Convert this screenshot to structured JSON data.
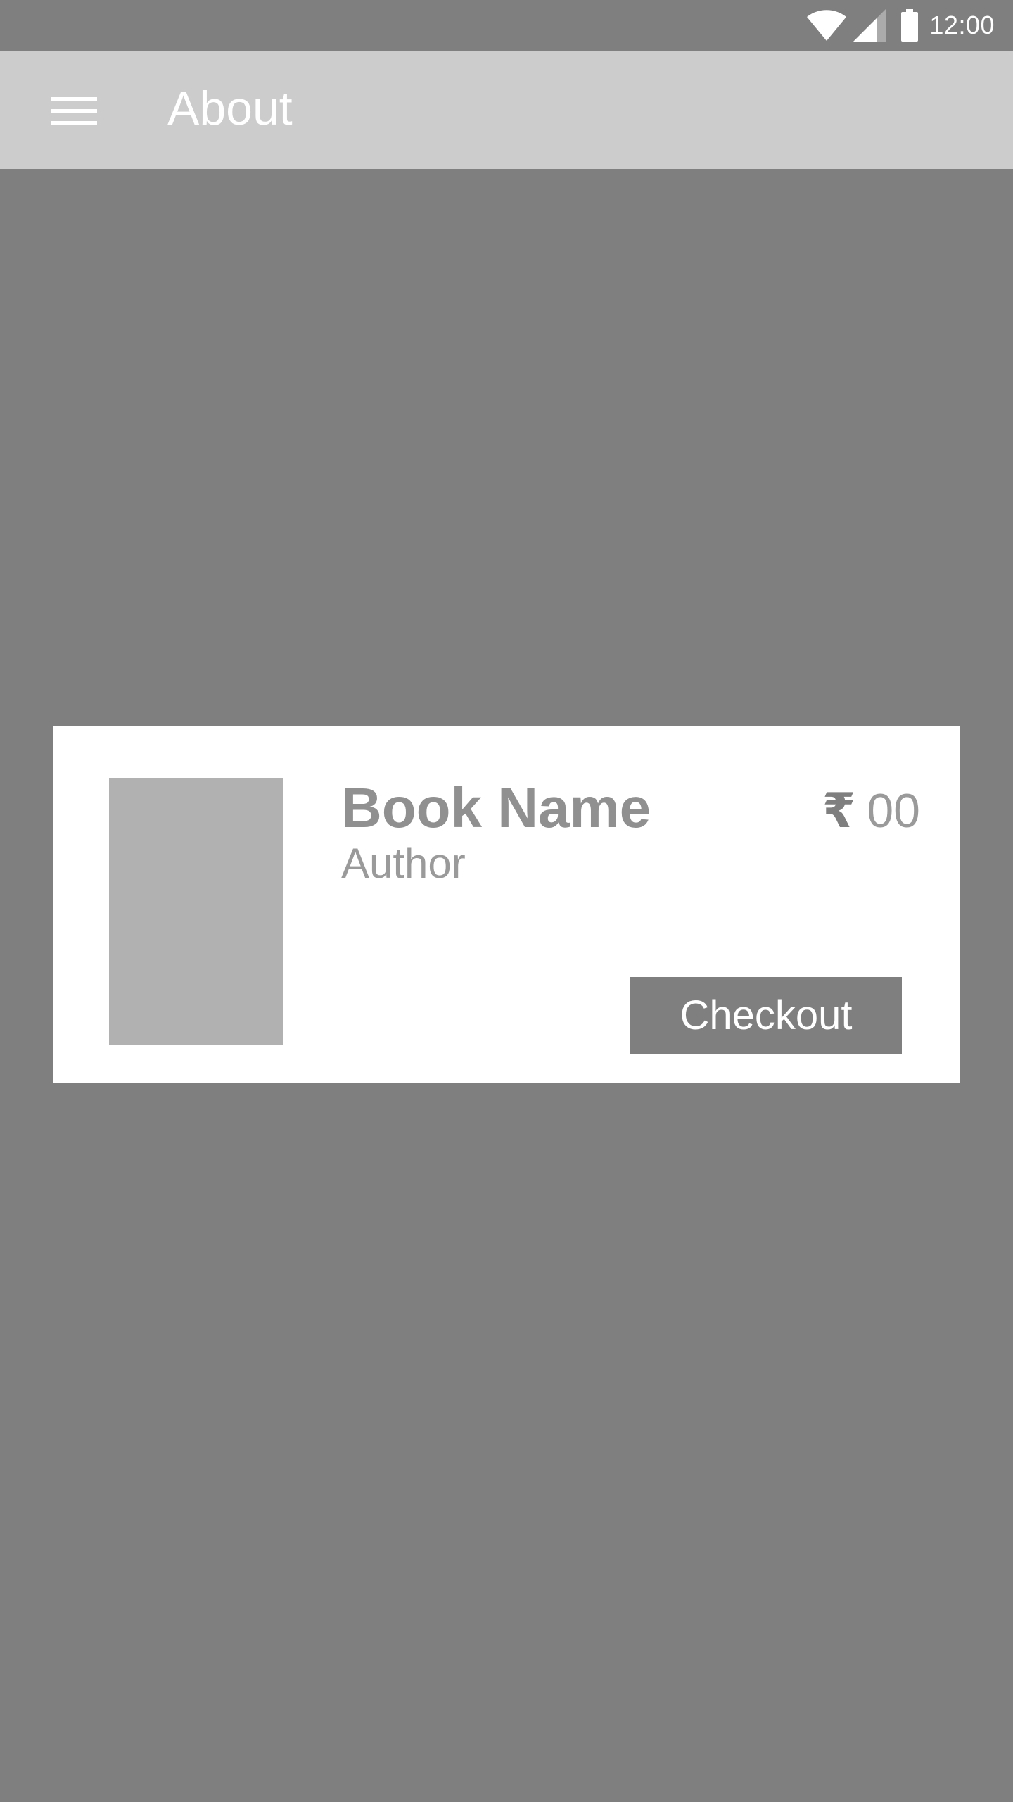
{
  "status_bar": {
    "time": "12:00",
    "icons": [
      "wifi-icon",
      "signal-icon",
      "battery-icon"
    ]
  },
  "app_bar": {
    "title": "About",
    "menu_icon": "hamburger-menu-icon"
  },
  "book_card": {
    "name": "Book Name",
    "author": "Author",
    "currency_symbol": "₹",
    "price": "00",
    "checkout_label": "Checkout"
  },
  "colors": {
    "background": "#7f7f7f",
    "app_bar": "#cccccc",
    "card": "#ffffff",
    "cover_placeholder": "#b1b1b1",
    "button": "#7f7f7f",
    "text_muted": "#9a9a9a"
  }
}
